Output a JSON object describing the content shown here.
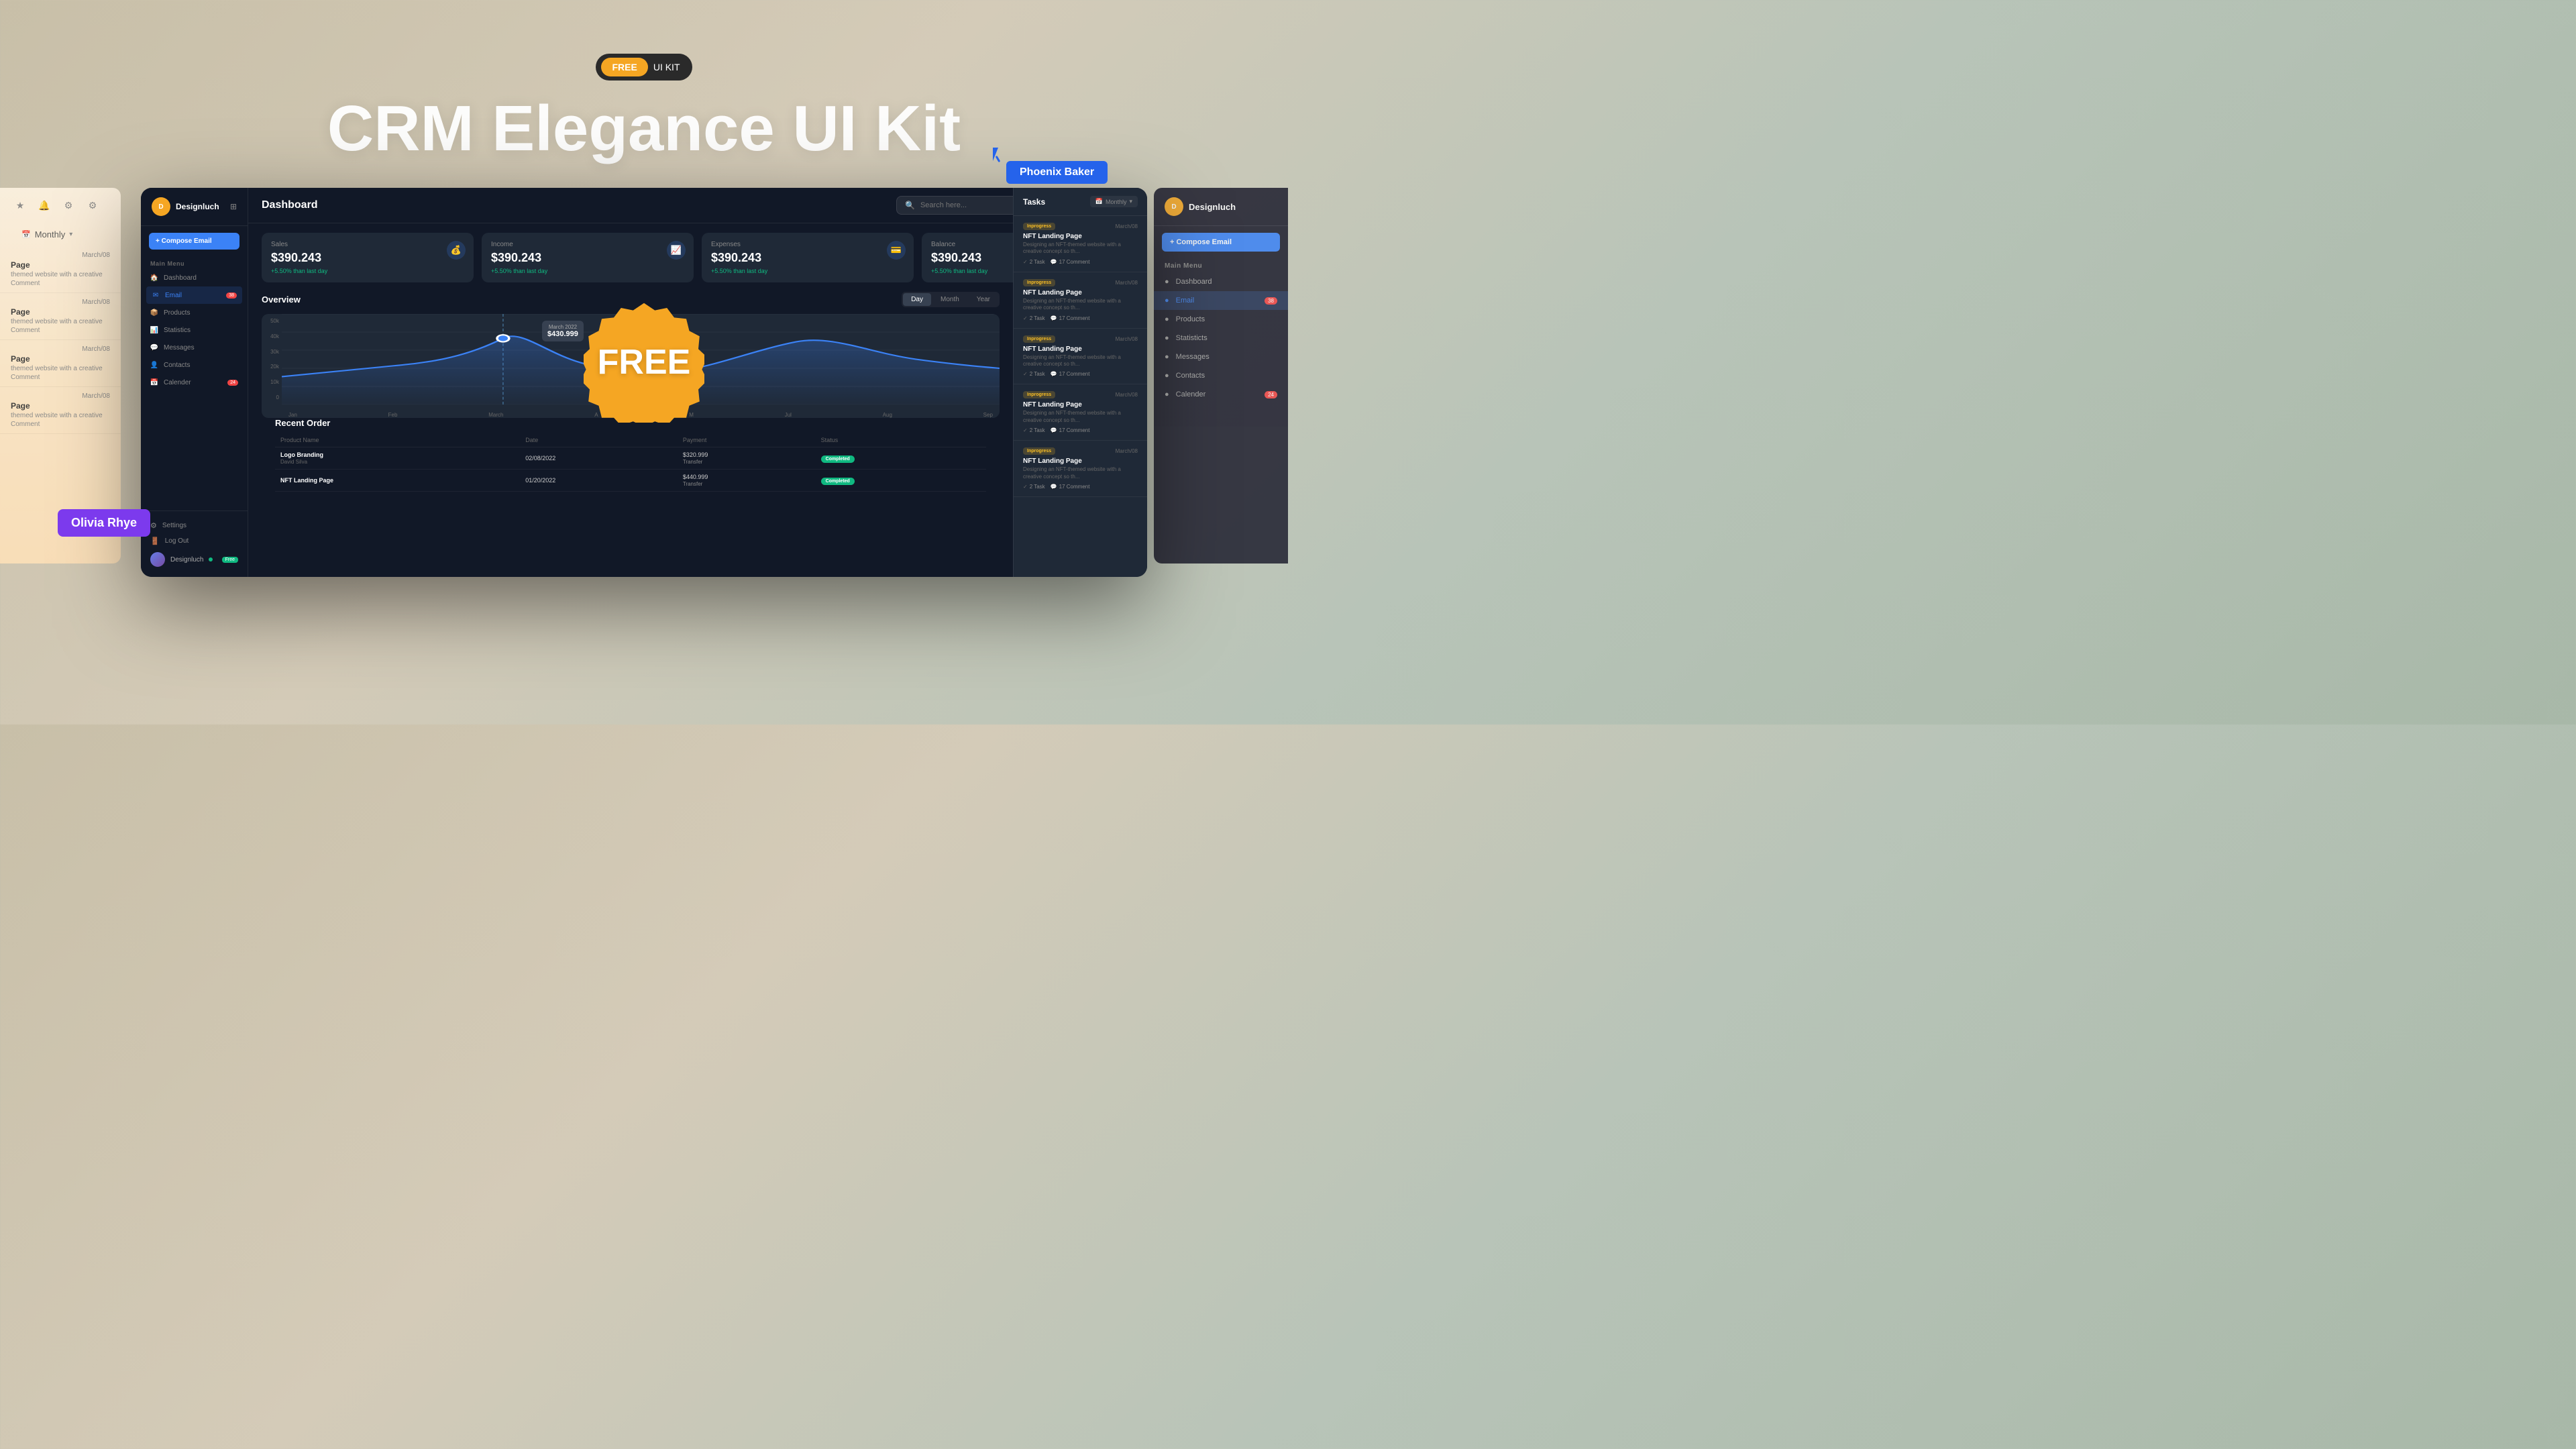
{
  "hero": {
    "badge_free": "FREE",
    "badge_uikit": "UI KIT",
    "title": "CRM Elegance UI Kit",
    "cursor_user": "Phoenix Baker",
    "olivia_user": "Olivia Rhye"
  },
  "dashboard": {
    "brand": "Designluch",
    "header_title": "Dashboard",
    "search_placeholder": "Search here...",
    "compose_btn": "+ Compose Email",
    "main_menu_label": "Main Menu",
    "menu_items": [
      {
        "label": "Dashboard",
        "icon": "🏠",
        "active": false,
        "badge": null
      },
      {
        "label": "Email",
        "icon": "✉",
        "active": true,
        "badge": "38"
      },
      {
        "label": "Products",
        "icon": "📦",
        "active": false,
        "badge": null
      },
      {
        "label": "Statistics",
        "icon": "📊",
        "active": false,
        "badge": null
      },
      {
        "label": "Messages",
        "icon": "💬",
        "active": false,
        "badge": null
      },
      {
        "label": "Contacts",
        "icon": "👤",
        "active": false,
        "badge": null
      },
      {
        "label": "Calender",
        "icon": "📅",
        "active": false,
        "badge": "24"
      }
    ],
    "footer_items": [
      {
        "label": "Settings",
        "icon": "⚙"
      },
      {
        "label": "Log Out",
        "icon": "🚪"
      }
    ],
    "user": {
      "name": "Designluch",
      "tag": "Free"
    },
    "stats": [
      {
        "label": "Sales",
        "value": "$390.243",
        "change": "+5.50% than last day",
        "icon": "💰"
      },
      {
        "label": "Income",
        "value": "$390.243",
        "change": "+5.50% than last day",
        "icon": "📈"
      },
      {
        "label": "Expenses",
        "value": "$390.243",
        "change": "+5.50% than last day",
        "icon": "💳"
      },
      {
        "label": "Balance",
        "value": "$390.243",
        "change": "+5.50% than last day",
        "icon": "⚖"
      }
    ],
    "overview": {
      "title": "Overview",
      "time_tabs": [
        "Day",
        "Month",
        "Year"
      ],
      "active_tab": "Day",
      "chart": {
        "y_labels": [
          "50k",
          "40k",
          "30k",
          "20k",
          "10k",
          "0"
        ],
        "x_labels": [
          "Jan",
          "Feb",
          "March",
          "A",
          "M",
          "Jul",
          "Aug",
          "Sep"
        ],
        "tooltip_date": "March 2022",
        "tooltip_value": "$430.999"
      }
    },
    "recent_order": {
      "title": "Recent Order",
      "columns": [
        "Product Name",
        "Date",
        "Payment",
        "Status"
      ],
      "rows": [
        {
          "name": "Logo Branding",
          "sub": "David Silva",
          "date": "02/08/2022",
          "payment": "$320.999",
          "method": "Transfer",
          "status": "Completed"
        },
        {
          "name": "NFT Landing Page",
          "sub": "",
          "date": "01/20/2022",
          "payment": "$440.999",
          "method": "Transfer",
          "status": "Completed"
        }
      ]
    },
    "tasks": {
      "title": "Tasks",
      "filter": "Monthly",
      "items": [
        {
          "status": "Inprogress",
          "date": "March/08",
          "title": "NFT Landing Page",
          "desc": "Designing an NFT-themed website with a creative concept so th...",
          "tasks": "2 Task",
          "comments": "17 Comment"
        },
        {
          "status": "Inprogress",
          "date": "March/08",
          "title": "NFT Landing Page",
          "desc": "Designing an NFT-themed website with a creative concept so th...",
          "tasks": "2 Task",
          "comments": "17 Comment"
        },
        {
          "status": "Inprogress",
          "date": "March/08",
          "title": "NFT Landing Page",
          "desc": "Designing an NFT-themed website with a creative concept so th...",
          "tasks": "2 Task",
          "comments": "17 Comment"
        },
        {
          "status": "Inprogress",
          "date": "March/08",
          "title": "NFT Landing Page",
          "desc": "Designing an NFT-themed website with a creative concept so th...",
          "tasks": "2 Task",
          "comments": "17 Comment"
        },
        {
          "status": "Inprogress",
          "date": "March/08",
          "title": "NFT Landing Page",
          "desc": "Designing an NFT-themed website with a creative concept so th...",
          "tasks": "2 Task",
          "comments": "17 Comment"
        }
      ]
    }
  },
  "left_panel": {
    "monthly": "Monthly",
    "tasks": [
      {
        "date": "March/08",
        "title": "Page",
        "desc": "themed website with a creative",
        "comment": "Comment"
      },
      {
        "date": "March/08",
        "title": "Page",
        "desc": "themed website with a creative",
        "comment": "Comment"
      },
      {
        "date": "March/08",
        "title": "Page",
        "desc": "themed website with a creative",
        "comment": "Comment"
      },
      {
        "date": "March/08",
        "title": "Page",
        "desc": "themed website with a creative",
        "comment": "Comment"
      }
    ]
  },
  "right_panel": {
    "brand": "Designluch",
    "compose_btn": "+ Compose Email",
    "menu_label": "Main Menu",
    "menu_items": [
      {
        "label": "Dashboard",
        "active": false,
        "badge": null
      },
      {
        "label": "Email",
        "active": true,
        "badge": "38"
      },
      {
        "label": "Products",
        "active": false,
        "badge": null
      },
      {
        "label": "Statisticts",
        "active": false,
        "badge": null
      },
      {
        "label": "Messages",
        "active": false,
        "badge": null
      },
      {
        "label": "Contacts",
        "active": false,
        "badge": null
      },
      {
        "label": "Calender",
        "active": false,
        "badge": "24"
      }
    ]
  },
  "free_sticker": {
    "text": "FREE"
  },
  "colors": {
    "accent_blue": "#3b82f6",
    "accent_orange": "#f5a623",
    "accent_green": "#10b981",
    "accent_purple": "#7c3aed",
    "bg_dark": "#111827",
    "bg_card": "#1f2937"
  }
}
